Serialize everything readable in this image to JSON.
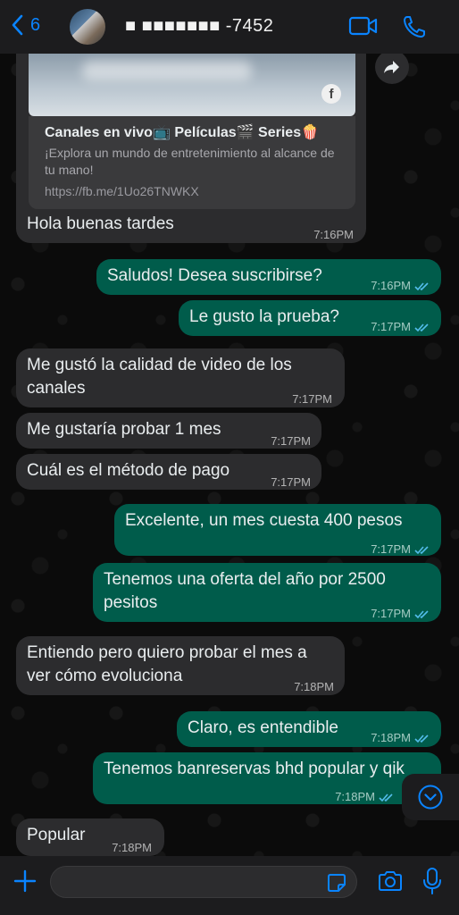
{
  "header": {
    "back_count": "6",
    "contact_title": "■ ■■■■■■■ -7452"
  },
  "link_preview": {
    "title": "Canales en vivo📺 Películas🎬 Series🍿",
    "description": "¡Explora un mundo de entretenimiento al alcance de tu mano!",
    "url": "https://fb.me/1Uo26TNWKX",
    "badge": "f"
  },
  "messages": [
    {
      "id": "m1",
      "direction": "incoming",
      "text": "Hola buenas tardes",
      "time": "7:16PM"
    },
    {
      "id": "m2",
      "direction": "outgoing",
      "text": "Saludos! Desea suscribirse?",
      "time": "7:16PM",
      "read": true
    },
    {
      "id": "m3",
      "direction": "outgoing",
      "text": "Le gusto la prueba?",
      "time": "7:17PM",
      "read": true
    },
    {
      "id": "m4",
      "direction": "incoming",
      "text": "Me gustó la calidad de video de los canales",
      "time": "7:17PM"
    },
    {
      "id": "m5",
      "direction": "incoming",
      "text": "Me gustaría probar 1 mes",
      "time": "7:17PM"
    },
    {
      "id": "m6",
      "direction": "incoming",
      "text": "Cuál es el método de pago",
      "time": "7:17PM"
    },
    {
      "id": "m7",
      "direction": "outgoing",
      "text": "Excelente, un mes cuesta 400 pesos",
      "time": "7:17PM",
      "read": true
    },
    {
      "id": "m8",
      "direction": "outgoing",
      "text": "Tenemos una oferta del año por 2500 pesitos",
      "time": "7:17PM",
      "read": true
    },
    {
      "id": "m9",
      "direction": "incoming",
      "text": "Entiendo pero quiero probar el mes a ver cómo evoluciona",
      "time": "7:18PM"
    },
    {
      "id": "m10",
      "direction": "outgoing",
      "text": "Claro, es entendible",
      "time": "7:18PM",
      "read": true
    },
    {
      "id": "m11",
      "direction": "outgoing",
      "text": "Tenemos banreservas bhd popular y qik",
      "time": "7:18PM",
      "read": true
    },
    {
      "id": "m12",
      "direction": "incoming",
      "text": "Popular",
      "time": "7:18PM"
    }
  ],
  "colors": {
    "accent": "#0a84ff",
    "incoming_bubble": "#2c2c2e",
    "outgoing_bubble": "#005c4b",
    "read_ticks": "#53bdeb"
  },
  "icons": [
    "back-chevron-icon",
    "video-call-icon",
    "phone-icon",
    "forward-icon",
    "facebook-icon",
    "scroll-down-icon",
    "plus-icon",
    "sticker-icon",
    "camera-icon",
    "microphone-icon",
    "read-ticks-icon"
  ]
}
